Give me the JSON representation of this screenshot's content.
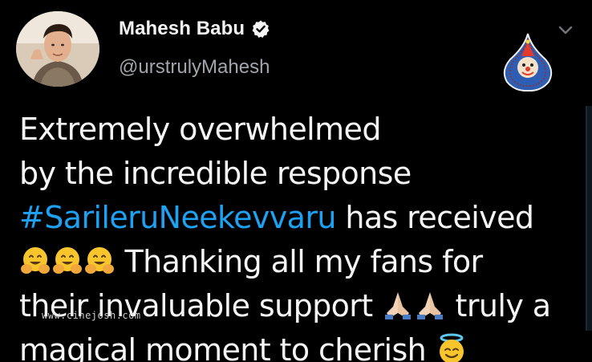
{
  "author": {
    "display_name": "Mahesh Babu",
    "handle": "@urstrulyMahesh",
    "verified": true
  },
  "tweet": {
    "line1": "Extremely overwhelmed",
    "line2": "by the incredible response",
    "hashtag": "#SarileruNeekevvaru",
    "line3_rest": " has received",
    "line4_text": " Thanking all my fans for",
    "line5_a": "their invaluable support ",
    "line5_b": " truly a",
    "line6_text": "magical moment to cherish "
  },
  "icons": {
    "verified": "verified-badge-icon",
    "menu": "chevron-down-icon",
    "hug_emoji": "hugging-face-emoji",
    "pray_emoji": "folded-hands-emoji",
    "halo_emoji": "smiling-face-with-halo-emoji"
  },
  "watermark": {
    "text": "www.cinejosh.com"
  },
  "colors": {
    "background": "#000000",
    "text": "#f5f5f5",
    "handle": "#a0a6ab",
    "hashtag": "#1da1f2"
  }
}
